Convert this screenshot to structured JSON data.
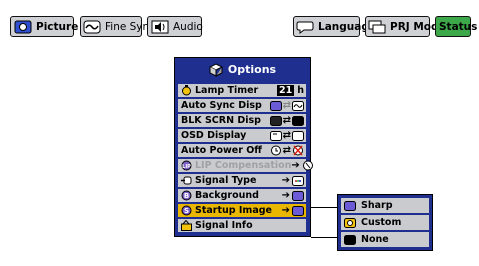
{
  "tabs": [
    {
      "label": "Picture",
      "icon": "picture-icon"
    },
    {
      "label": "Fine Sync",
      "icon": "fine-sync-icon"
    },
    {
      "label": "Audio",
      "icon": "audio-icon"
    },
    {
      "label": "Language",
      "icon": "language-icon"
    },
    {
      "label": "PRJ Mode",
      "icon": "prj-mode-icon"
    },
    {
      "label": "Status",
      "icon": ""
    }
  ],
  "selected_tab": "Status",
  "menu": {
    "title": "Options",
    "items": [
      {
        "label": "Lamp Timer",
        "value": "21",
        "unit": "h",
        "icon": "lamp-timer-icon"
      },
      {
        "label": "Auto Sync Disp",
        "icon": ""
      },
      {
        "label": "BLK SCRN Disp",
        "icon": ""
      },
      {
        "label": "OSD Display",
        "icon": ""
      },
      {
        "label": "Auto Power Off",
        "icon": ""
      },
      {
        "label": "LIP Compensation",
        "icon": "lip-icon",
        "disabled": true
      },
      {
        "label": "Signal Type",
        "icon": "signal-type-icon"
      },
      {
        "label": "Background",
        "icon": "background-icon"
      },
      {
        "label": "Startup Image",
        "icon": "startup-image-icon",
        "selected": true
      },
      {
        "label": "Signal Info",
        "icon": "signal-info-icon"
      }
    ]
  },
  "submenu": {
    "items": [
      {
        "label": "Sharp",
        "icon": "sharp-icon"
      },
      {
        "label": "Custom",
        "icon": "custom-icon"
      },
      {
        "label": "None",
        "icon": "none-icon"
      }
    ]
  },
  "colors": {
    "menu_bg": "#1e2f8f",
    "item_bg": "#c9cbce",
    "selected": "#e9b600",
    "status_tab": "#3da84a"
  }
}
